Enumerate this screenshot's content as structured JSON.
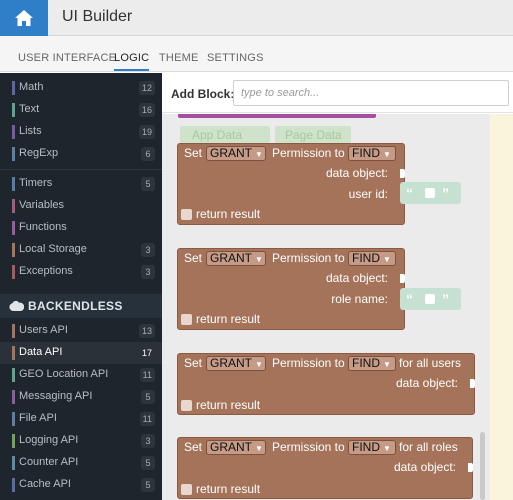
{
  "header": {
    "title": "UI Builder",
    "home_icon": "home-icon"
  },
  "tabs": [
    {
      "label": "USER INTERFACE",
      "active": false
    },
    {
      "label": "LOGIC",
      "active": true
    },
    {
      "label": "THEME",
      "active": false
    },
    {
      "label": "SETTINGS",
      "active": false
    }
  ],
  "sidebar": {
    "group1": [
      {
        "label": "Math",
        "count": "12",
        "color": "#5b67a5"
      },
      {
        "label": "Text",
        "count": "16",
        "color": "#5ba58c"
      },
      {
        "label": "Lists",
        "count": "19",
        "color": "#745ba5"
      },
      {
        "label": "RegExp",
        "count": "6",
        "color": "#5b80a5"
      }
    ],
    "group2": [
      {
        "label": "Timers",
        "count": "5",
        "color": "#5b7ca5"
      },
      {
        "label": "Variables",
        "count": "",
        "color": "#a55b80"
      },
      {
        "label": "Functions",
        "count": "",
        "color": "#995ba5"
      },
      {
        "label": "Local Storage",
        "count": "3",
        "color": "#a5745b"
      },
      {
        "label": "Exceptions",
        "count": "3",
        "color": "#a55b5b"
      }
    ],
    "section": {
      "label": "BACKENDLESS",
      "icon": "cloud-icon"
    },
    "group3": [
      {
        "label": "Users API",
        "count": "13",
        "color": "#a5745b"
      },
      {
        "label": "Data API",
        "count": "17",
        "color": "#a5745b",
        "active": true
      },
      {
        "label": "GEO Location API",
        "count": "11",
        "color": "#5ba58c"
      },
      {
        "label": "Messaging API",
        "count": "5",
        "color": "#8c5ba5"
      },
      {
        "label": "File API",
        "count": "11",
        "color": "#5b80a5"
      },
      {
        "label": "Logging API",
        "count": "3",
        "color": "#6ca55b"
      },
      {
        "label": "Counter API",
        "count": "5",
        "color": "#5b8ca5"
      },
      {
        "label": "Cache API",
        "count": "5",
        "color": "#5b6ca5"
      }
    ]
  },
  "add_block": {
    "label": "Add Block:",
    "placeholder": "type to search..."
  },
  "workspace": {
    "ghost_labels": [
      "App Data",
      "Page Data"
    ],
    "common": {
      "set": "Set",
      "grant": "GRANT",
      "permission_to": "Permission to",
      "find": "FIND",
      "return_result": "return result",
      "quote_open": "“",
      "quote_close": "”"
    },
    "blocks": [
      {
        "suffix": "",
        "fields": [
          "data object:",
          "user id:"
        ],
        "string_input_on": "user id:"
      },
      {
        "suffix": "",
        "fields": [
          "data object:",
          "role name:"
        ],
        "string_input_on": "role name:"
      },
      {
        "suffix": "for all users",
        "fields": [
          "data object:"
        ]
      },
      {
        "suffix": "for all roles",
        "fields": [
          "data object:"
        ]
      }
    ]
  },
  "colors": {
    "accent": "#2e7fc7",
    "sidebar_bg": "#1e252d",
    "block": "#a5735a",
    "string_block": "#c6e0d2",
    "purple_block": "#a64ea1"
  }
}
